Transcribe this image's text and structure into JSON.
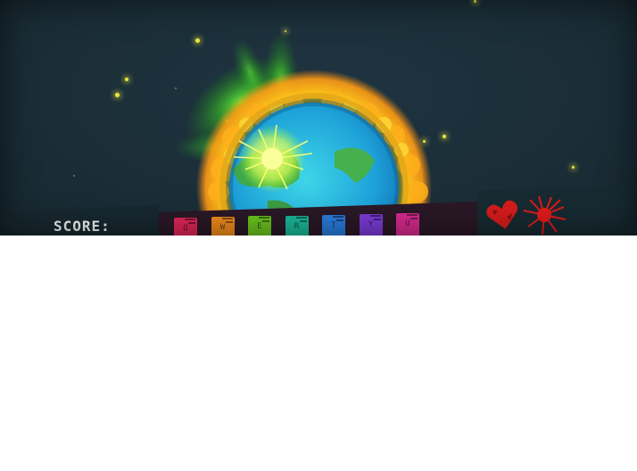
{
  "hud": {
    "score_label": "SCORE:",
    "score_value": ""
  },
  "keys": [
    {
      "char": "Q",
      "color": "#e0265a"
    },
    {
      "char": "W",
      "color": "#f08a1c"
    },
    {
      "char": "E",
      "color": "#6ac41e"
    },
    {
      "char": "R",
      "color": "#19b899"
    },
    {
      "char": "T",
      "color": "#2a7cdc"
    },
    {
      "char": "Y",
      "color": "#7b3bd6"
    },
    {
      "char": "U",
      "color": "#d62a8e"
    }
  ],
  "status": {
    "heart_icon": "heart-icon",
    "burst_icon": "burst-icon",
    "accent": "#d41c1c"
  },
  "scene": {
    "planet": "earth",
    "sun_color": "#ffb11a",
    "glow_color": "#3fd82a"
  }
}
